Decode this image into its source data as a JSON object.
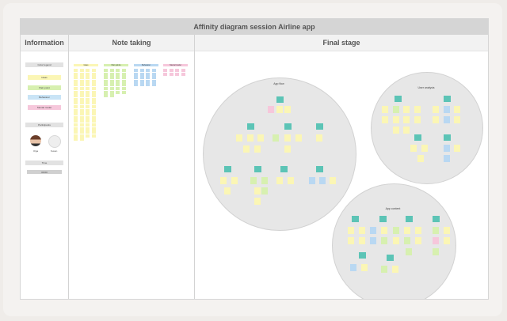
{
  "board": {
    "title": "Affinity diagram session Airline app"
  },
  "columns": {
    "information": "Information",
    "note_taking": "Note taking",
    "final_stage": "Final stage"
  },
  "info": {
    "color_legend_title": "Color legend",
    "legend": [
      {
        "label": "Ideas",
        "color": "#fbf6b5"
      },
      {
        "label": "Pain point",
        "color": "#d7f0b0"
      },
      {
        "label": "Behaviour",
        "color": "#c9e4f6"
      },
      {
        "label": "Mental model",
        "color": "#f6c7db"
      }
    ],
    "participants_title": "Participants",
    "participants": [
      {
        "name": "Olga"
      },
      {
        "name": "Susan"
      }
    ],
    "time_title": "Time",
    "time_value": "00:00"
  },
  "note_categories": [
    {
      "label": "Ideas",
      "color": "#fbf6b5"
    },
    {
      "label": "Pain points",
      "color": "#d7f0b0"
    },
    {
      "label": "Behaviour",
      "color": "#b9d8f2"
    },
    {
      "label": "Mental model",
      "color": "#f6c7db"
    }
  ],
  "clusters": [
    {
      "label": "App flow"
    },
    {
      "label": "User analysis"
    },
    {
      "label": "App content"
    }
  ],
  "colors": {
    "teal": "#5cc4b6",
    "yellow": "#fbf6b5",
    "green": "#d7f0b0",
    "blue": "#b9d8f2",
    "pink": "#f6c7db"
  }
}
